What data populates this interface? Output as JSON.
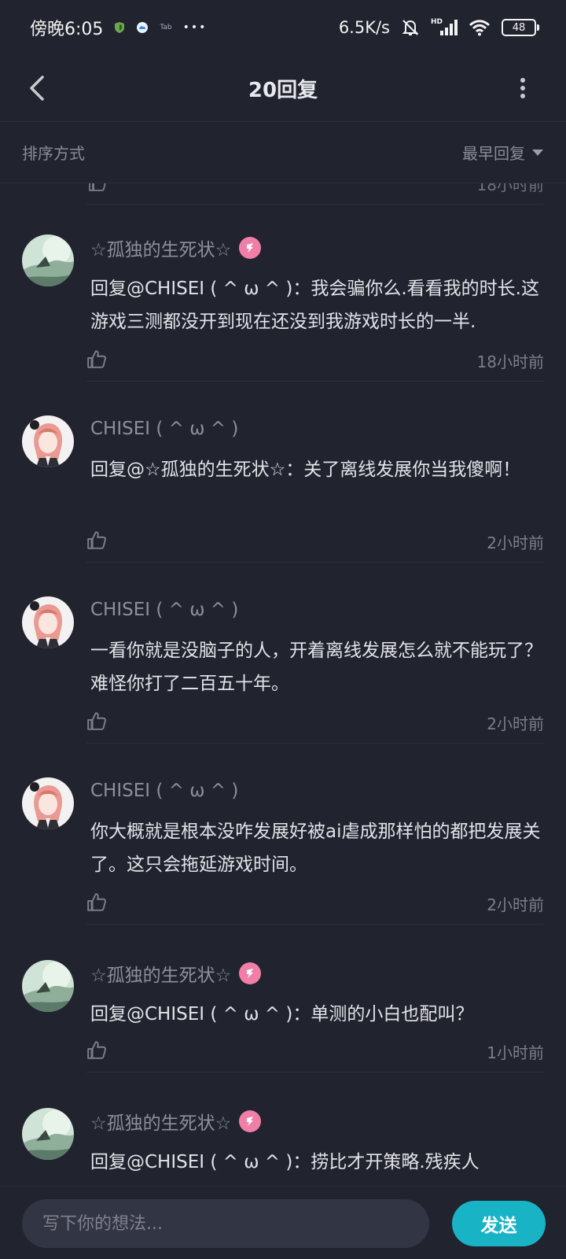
{
  "status_bar": {
    "time": "傍晚6:05",
    "tb_label": "Tab",
    "dots": "•••",
    "net_speed": "6.5K/s",
    "hd_label": "HD",
    "battery": "48"
  },
  "header": {
    "title": "20回复"
  },
  "sort": {
    "label": "排序方式",
    "selected": "最早回复"
  },
  "partial_item": {
    "time": "18小时前"
  },
  "replies": [
    {
      "name": "☆孤独的生死状☆",
      "has_badge": true,
      "avatar": "landscape",
      "text": "回复@CHISEI ( ^ ω ^ )：我会骗你么.看看我的时长.这游戏三测都没开到现在还没到我游戏时长的一半.",
      "time": "18小时前"
    },
    {
      "name": "CHISEI ( ^ ω ^ )",
      "has_badge": false,
      "avatar": "anime",
      "text": "回复@☆孤独的生死状☆：关了离线发展你当我傻啊！",
      "time": "2小时前"
    },
    {
      "name": "CHISEI ( ^ ω ^ )",
      "has_badge": false,
      "avatar": "anime",
      "text": "一看你就是没脑子的人，开着离线发展怎么就不能玩了？难怪你打了二百五十年。",
      "time": "2小时前"
    },
    {
      "name": "CHISEI ( ^ ω ^ )",
      "has_badge": false,
      "avatar": "anime",
      "text": "你大概就是根本没咋发展好被ai虐成那样怕的都把发展关了。这只会拖延游戏时间。",
      "time": "2小时前"
    },
    {
      "name": "☆孤独的生死状☆",
      "has_badge": true,
      "avatar": "landscape",
      "text": "回复@CHISEI ( ^ ω ^ )：单测的小白也配叫？",
      "time": "1小时前"
    },
    {
      "name": "☆孤独的生死状☆",
      "has_badge": true,
      "avatar": "landscape",
      "text": "回复@CHISEI ( ^ ω ^ )：捞比才开策略.残疾人",
      "time": ""
    }
  ],
  "input": {
    "placeholder": "写下你的想法..."
  },
  "send_label": "发送",
  "colors": {
    "background": "#21232e",
    "accent": "#18b4c6",
    "badge": "#f07fa8"
  }
}
